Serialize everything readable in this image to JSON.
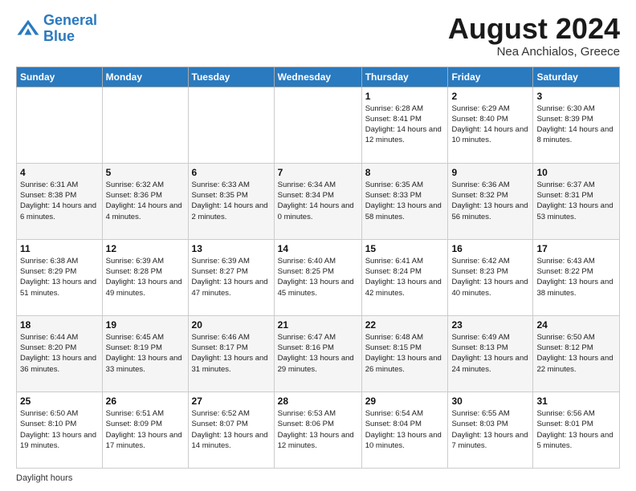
{
  "logo": {
    "line1": "General",
    "line2": "Blue"
  },
  "title": "August 2024",
  "subtitle": "Nea Anchialos, Greece",
  "days_of_week": [
    "Sunday",
    "Monday",
    "Tuesday",
    "Wednesday",
    "Thursday",
    "Friday",
    "Saturday"
  ],
  "footer_label": "Daylight hours",
  "weeks": [
    [
      {
        "day": "",
        "info": ""
      },
      {
        "day": "",
        "info": ""
      },
      {
        "day": "",
        "info": ""
      },
      {
        "day": "",
        "info": ""
      },
      {
        "day": "1",
        "info": "Sunrise: 6:28 AM\nSunset: 8:41 PM\nDaylight: 14 hours and 12 minutes."
      },
      {
        "day": "2",
        "info": "Sunrise: 6:29 AM\nSunset: 8:40 PM\nDaylight: 14 hours and 10 minutes."
      },
      {
        "day": "3",
        "info": "Sunrise: 6:30 AM\nSunset: 8:39 PM\nDaylight: 14 hours and 8 minutes."
      }
    ],
    [
      {
        "day": "4",
        "info": "Sunrise: 6:31 AM\nSunset: 8:38 PM\nDaylight: 14 hours and 6 minutes."
      },
      {
        "day": "5",
        "info": "Sunrise: 6:32 AM\nSunset: 8:36 PM\nDaylight: 14 hours and 4 minutes."
      },
      {
        "day": "6",
        "info": "Sunrise: 6:33 AM\nSunset: 8:35 PM\nDaylight: 14 hours and 2 minutes."
      },
      {
        "day": "7",
        "info": "Sunrise: 6:34 AM\nSunset: 8:34 PM\nDaylight: 14 hours and 0 minutes."
      },
      {
        "day": "8",
        "info": "Sunrise: 6:35 AM\nSunset: 8:33 PM\nDaylight: 13 hours and 58 minutes."
      },
      {
        "day": "9",
        "info": "Sunrise: 6:36 AM\nSunset: 8:32 PM\nDaylight: 13 hours and 56 minutes."
      },
      {
        "day": "10",
        "info": "Sunrise: 6:37 AM\nSunset: 8:31 PM\nDaylight: 13 hours and 53 minutes."
      }
    ],
    [
      {
        "day": "11",
        "info": "Sunrise: 6:38 AM\nSunset: 8:29 PM\nDaylight: 13 hours and 51 minutes."
      },
      {
        "day": "12",
        "info": "Sunrise: 6:39 AM\nSunset: 8:28 PM\nDaylight: 13 hours and 49 minutes."
      },
      {
        "day": "13",
        "info": "Sunrise: 6:39 AM\nSunset: 8:27 PM\nDaylight: 13 hours and 47 minutes."
      },
      {
        "day": "14",
        "info": "Sunrise: 6:40 AM\nSunset: 8:25 PM\nDaylight: 13 hours and 45 minutes."
      },
      {
        "day": "15",
        "info": "Sunrise: 6:41 AM\nSunset: 8:24 PM\nDaylight: 13 hours and 42 minutes."
      },
      {
        "day": "16",
        "info": "Sunrise: 6:42 AM\nSunset: 8:23 PM\nDaylight: 13 hours and 40 minutes."
      },
      {
        "day": "17",
        "info": "Sunrise: 6:43 AM\nSunset: 8:22 PM\nDaylight: 13 hours and 38 minutes."
      }
    ],
    [
      {
        "day": "18",
        "info": "Sunrise: 6:44 AM\nSunset: 8:20 PM\nDaylight: 13 hours and 36 minutes."
      },
      {
        "day": "19",
        "info": "Sunrise: 6:45 AM\nSunset: 8:19 PM\nDaylight: 13 hours and 33 minutes."
      },
      {
        "day": "20",
        "info": "Sunrise: 6:46 AM\nSunset: 8:17 PM\nDaylight: 13 hours and 31 minutes."
      },
      {
        "day": "21",
        "info": "Sunrise: 6:47 AM\nSunset: 8:16 PM\nDaylight: 13 hours and 29 minutes."
      },
      {
        "day": "22",
        "info": "Sunrise: 6:48 AM\nSunset: 8:15 PM\nDaylight: 13 hours and 26 minutes."
      },
      {
        "day": "23",
        "info": "Sunrise: 6:49 AM\nSunset: 8:13 PM\nDaylight: 13 hours and 24 minutes."
      },
      {
        "day": "24",
        "info": "Sunrise: 6:50 AM\nSunset: 8:12 PM\nDaylight: 13 hours and 22 minutes."
      }
    ],
    [
      {
        "day": "25",
        "info": "Sunrise: 6:50 AM\nSunset: 8:10 PM\nDaylight: 13 hours and 19 minutes."
      },
      {
        "day": "26",
        "info": "Sunrise: 6:51 AM\nSunset: 8:09 PM\nDaylight: 13 hours and 17 minutes."
      },
      {
        "day": "27",
        "info": "Sunrise: 6:52 AM\nSunset: 8:07 PM\nDaylight: 13 hours and 14 minutes."
      },
      {
        "day": "28",
        "info": "Sunrise: 6:53 AM\nSunset: 8:06 PM\nDaylight: 13 hours and 12 minutes."
      },
      {
        "day": "29",
        "info": "Sunrise: 6:54 AM\nSunset: 8:04 PM\nDaylight: 13 hours and 10 minutes."
      },
      {
        "day": "30",
        "info": "Sunrise: 6:55 AM\nSunset: 8:03 PM\nDaylight: 13 hours and 7 minutes."
      },
      {
        "day": "31",
        "info": "Sunrise: 6:56 AM\nSunset: 8:01 PM\nDaylight: 13 hours and 5 minutes."
      }
    ]
  ]
}
